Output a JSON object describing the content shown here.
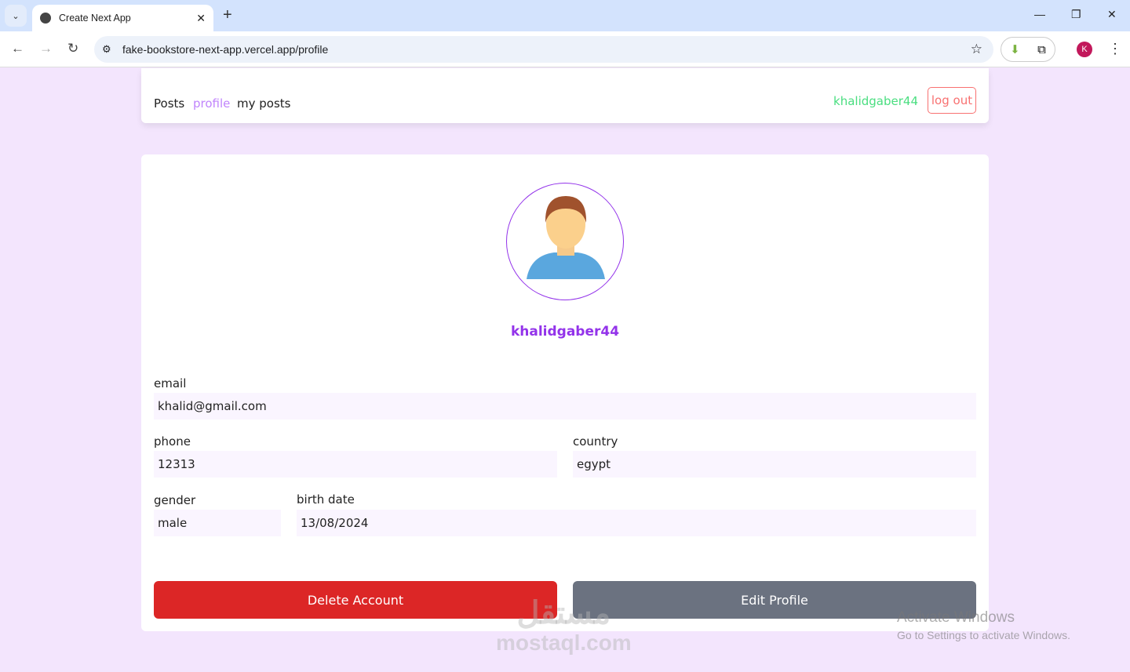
{
  "browser": {
    "tab_title": "Create Next App",
    "url": "fake-bookstore-next-app.vercel.app/profile",
    "profile_initial": "K"
  },
  "nav": {
    "links": [
      "Posts",
      "profile",
      "my posts"
    ],
    "username": "khalidgaber44",
    "logout": "log out"
  },
  "profile": {
    "username": "khalidgaber44",
    "fields": {
      "email": {
        "label": "email",
        "value": "khalid@gmail.com"
      },
      "phone": {
        "label": "phone",
        "value": "12313"
      },
      "country": {
        "label": "country",
        "value": "egypt"
      },
      "gender": {
        "label": "gender",
        "value": "male"
      },
      "birth_date": {
        "label": "birth date",
        "value": "13/08/2024"
      }
    },
    "delete_label": "Delete Account",
    "edit_label": "Edit Profile"
  },
  "colors": {
    "accent": "#9333ea",
    "delete": "#dc2626",
    "edit": "#6b7280",
    "username_nav": "#4ade80",
    "logout": "#f87171"
  },
  "watermark": {
    "arabic": "مستقل",
    "latin": "mostaql.com"
  },
  "activation": {
    "title": "Activate Windows",
    "subtitle": "Go to Settings to activate Windows."
  }
}
